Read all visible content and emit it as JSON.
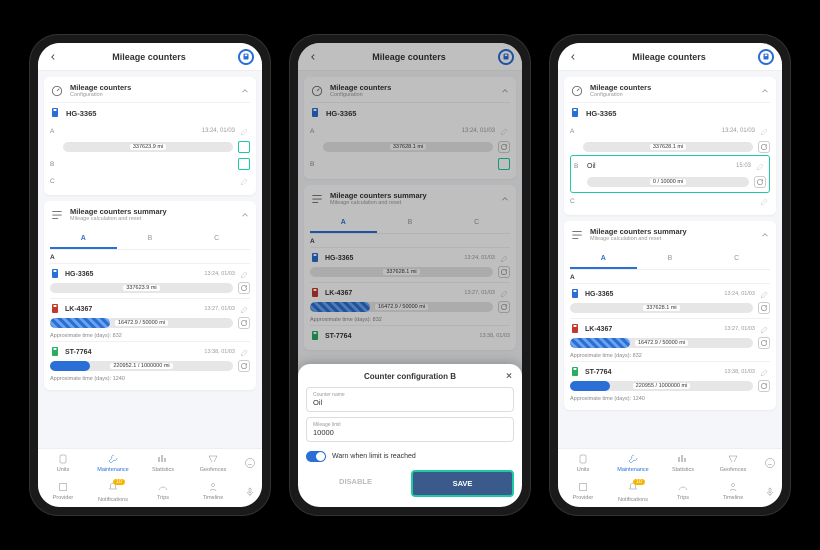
{
  "header": {
    "title": "Mileage counters"
  },
  "cards": {
    "config": {
      "title": "Mileage counters",
      "subtitle": "Configuration"
    },
    "summary": {
      "title": "Mileage counters summary",
      "subtitle": "Mileage calculation and reset"
    }
  },
  "unit_primary": "HG-3365",
  "counters_s1": {
    "A": {
      "label": "A",
      "time": "13:24, 01/03",
      "progress_text": "337623.9 mi"
    },
    "B": {
      "label": "B"
    },
    "C": {
      "label": "C"
    }
  },
  "counters_s2_A": {
    "label": "A",
    "time": "13:24, 01/03",
    "progress_text": "337628.1 mi"
  },
  "counters_s2_B": {
    "label": "B"
  },
  "counters_s3_A": {
    "label": "A",
    "time": "13:24, 01/03",
    "progress_text": "337628.1 mi"
  },
  "counters_s3_B": {
    "label": "B",
    "name": "Oil",
    "time": "15:03",
    "progress_text": "0 / 10000 mi"
  },
  "counters_s3_C": {
    "label": "C"
  },
  "tabs": {
    "A": "A",
    "B": "B",
    "C": "C"
  },
  "summary_cat": "A",
  "summary_units": {
    "hg": {
      "name": "HG-3365",
      "time": "13:24, 01/03",
      "progress_text_s1": "337623.9 mi",
      "progress_text_s2": "337628.1 mi",
      "progress_text_s3": "337628.1 mi"
    },
    "lk": {
      "name": "LK-4367",
      "time": "13:27, 01/03",
      "progress_text": "16472.9 / 50000 mi",
      "fill_pct": 33,
      "approx": "Approximate time (days): 832"
    },
    "st": {
      "name": "ST-7764",
      "time": "13:38, 01/03",
      "progress_text_s1": "220952.1 / 1000000 mi",
      "progress_text_s3": "220955 / 1000000 mi",
      "fill_pct": 22,
      "approx": "Approximate time (days): 1240"
    }
  },
  "sheet": {
    "title": "Counter configuration B",
    "name_label": "Counter name",
    "name_value": "Oil",
    "limit_label": "Mileage limit",
    "limit_value": "10000",
    "warn_label": "Warn when limit is reached",
    "disable": "DISABLE",
    "save": "SAVE"
  },
  "nav": {
    "row1": [
      "Units",
      "Maintenance",
      "Statistics",
      "Geofences"
    ],
    "row2": [
      "Provider",
      "Notifications",
      "Trips",
      "Timeline"
    ],
    "badge_notifications": "10"
  }
}
